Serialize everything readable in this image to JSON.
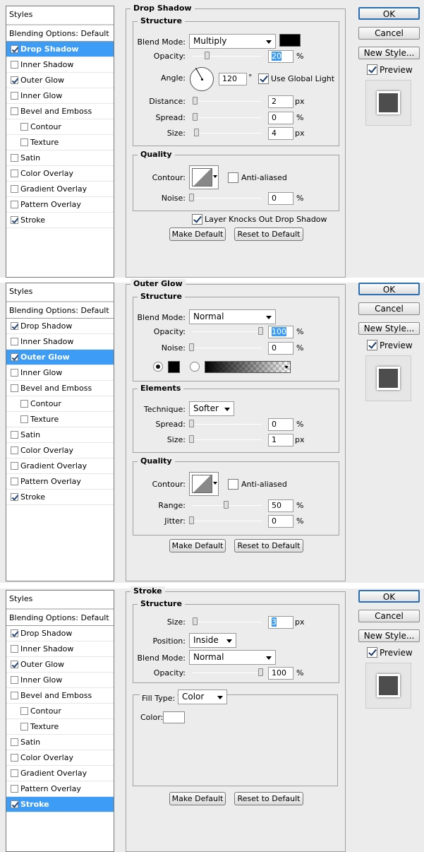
{
  "styles_list": {
    "header": "Styles",
    "blending": "Blending Options: Default",
    "items": [
      {
        "label": "Drop Shadow"
      },
      {
        "label": "Inner Shadow"
      },
      {
        "label": "Outer Glow"
      },
      {
        "label": "Inner Glow"
      },
      {
        "label": "Bevel and Emboss"
      },
      {
        "label": "Contour"
      },
      {
        "label": "Texture"
      },
      {
        "label": "Satin"
      },
      {
        "label": "Color Overlay"
      },
      {
        "label": "Gradient Overlay"
      },
      {
        "label": "Pattern Overlay"
      },
      {
        "label": "Stroke"
      }
    ]
  },
  "buttons": {
    "ok": "OK",
    "cancel": "Cancel",
    "new_style": "New Style...",
    "preview": "Preview",
    "make_default": "Make Default",
    "reset_default": "Reset to Default"
  },
  "drop_shadow": {
    "title": "Drop Shadow",
    "structure": "Structure",
    "blend_mode_label": "Blend Mode:",
    "blend_mode": "Multiply",
    "opacity_label": "Opacity:",
    "opacity": "20",
    "angle_label": "Angle:",
    "angle": "120",
    "degree": "°",
    "use_global_light": "Use Global Light",
    "distance_label": "Distance:",
    "distance": "2",
    "spread_label": "Spread:",
    "spread": "0",
    "size_label": "Size:",
    "size": "4",
    "quality": "Quality",
    "contour_label": "Contour:",
    "anti_aliased": "Anti-aliased",
    "noise_label": "Noise:",
    "noise": "0",
    "knockout": "Layer Knocks Out Drop Shadow",
    "unit_pct": "%",
    "unit_px": "px",
    "color": "#000000"
  },
  "outer_glow": {
    "title": "Outer Glow",
    "structure": "Structure",
    "blend_mode_label": "Blend Mode:",
    "blend_mode": "Normal",
    "opacity_label": "Opacity:",
    "opacity": "100",
    "noise_label": "Noise:",
    "noise": "0",
    "elements": "Elements",
    "technique_label": "Technique:",
    "technique": "Softer",
    "spread_label": "Spread:",
    "spread": "0",
    "size_label": "Size:",
    "size": "1",
    "quality": "Quality",
    "contour_label": "Contour:",
    "anti_aliased": "Anti-aliased",
    "range_label": "Range:",
    "range": "50",
    "jitter_label": "Jitter:",
    "jitter": "0",
    "unit_pct": "%",
    "unit_px": "px",
    "color": "#000000"
  },
  "stroke": {
    "title": "Stroke",
    "structure": "Structure",
    "size_label": "Size:",
    "size": "3",
    "position_label": "Position:",
    "position": "Inside",
    "blend_mode_label": "Blend Mode:",
    "blend_mode": "Normal",
    "opacity_label": "Opacity:",
    "opacity": "100",
    "fill_type_label": "Fill Type:",
    "fill_type": "Color",
    "color_label": "Color:",
    "unit_pct": "%",
    "unit_px": "px",
    "color": "#ffffff"
  },
  "colors": {
    "selection": "#3d9cf5",
    "panel": "#ececec"
  }
}
